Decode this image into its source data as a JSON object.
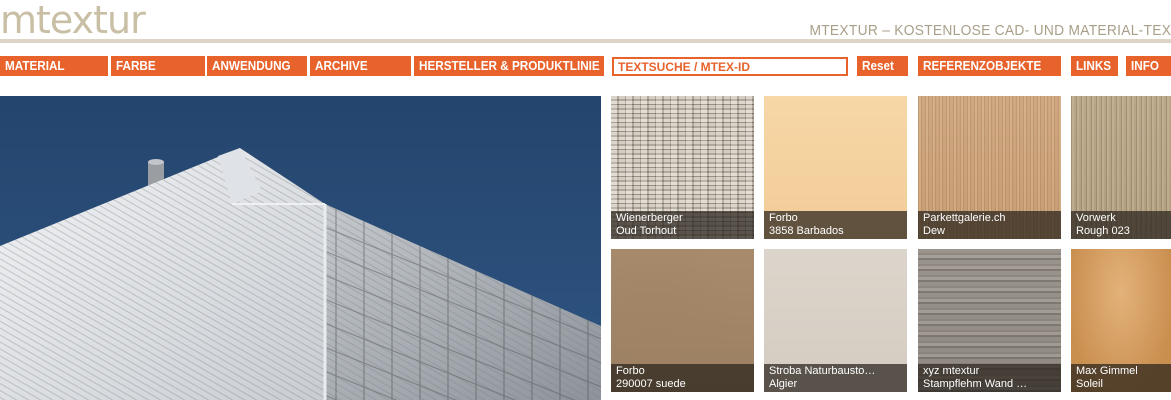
{
  "header": {
    "logo_text": "mtextur",
    "tagline": "MTEXTUR – KOSTENLOSE CAD- UND MATERIAL-TEX"
  },
  "nav": {
    "items": [
      "MATERIAL",
      "FARBE",
      "ANWENDUNG",
      "ARCHIVE",
      "HERSTELLER & PRODUKTLINIE"
    ],
    "search_placeholder": "TEXTSUCHE / MTEX-ID",
    "reset_label": "Reset",
    "referenzobjekte_label": "REFERENZOBJEKTE",
    "links_label": "LINKS",
    "info_label": "INFO"
  },
  "colors": {
    "accent": "#e8632c",
    "header_line": "#ddd6c6",
    "sky": "#2a4a72"
  },
  "tiles": [
    {
      "manufacturer": "Wienerberger",
      "product": "Oud Torhout"
    },
    {
      "manufacturer": "Forbo",
      "product": "3858 Barbados"
    },
    {
      "manufacturer": "Parkettgalerie.ch",
      "product": "Dew"
    },
    {
      "manufacturer": "Vorwerk",
      "product": "Rough 023"
    },
    {
      "manufacturer": "Forbo",
      "product": "290007 suede"
    },
    {
      "manufacturer": "Stroba Naturbausto…",
      "product": "Algier"
    },
    {
      "manufacturer": "xyz mtextur",
      "product": "Stampflehm Wand …"
    },
    {
      "manufacturer": "Max Gimmel",
      "product": "Soleil"
    }
  ]
}
